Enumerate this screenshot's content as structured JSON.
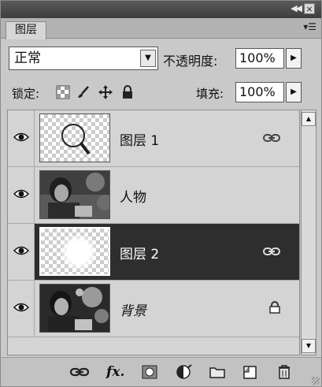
{
  "panel": {
    "tab_label": "图层"
  },
  "blend": {
    "mode": "正常",
    "opacity_label": "不透明度:",
    "opacity_value": "100%"
  },
  "lock": {
    "label": "锁定:",
    "fill_label": "填充:",
    "fill_value": "100%"
  },
  "layers": [
    {
      "name": "图层 1",
      "italic": false,
      "selected": false,
      "visible": true,
      "badge": "link-icon"
    },
    {
      "name": "人物",
      "italic": false,
      "selected": false,
      "visible": true,
      "badge": ""
    },
    {
      "name": "图层 2",
      "italic": false,
      "selected": true,
      "visible": true,
      "badge": "link-icon"
    },
    {
      "name": "背景",
      "italic": true,
      "selected": false,
      "visible": true,
      "badge": "lock-icon"
    }
  ],
  "toolbar_icons": [
    "link-layers-icon",
    "fx-icon",
    "add-mask-icon",
    "adjustment-layer-icon",
    "new-group-icon",
    "new-layer-icon",
    "trash-icon"
  ],
  "colors": {
    "selected_row": "#2e2e2e",
    "panel_bg": "#c9c9c9"
  }
}
